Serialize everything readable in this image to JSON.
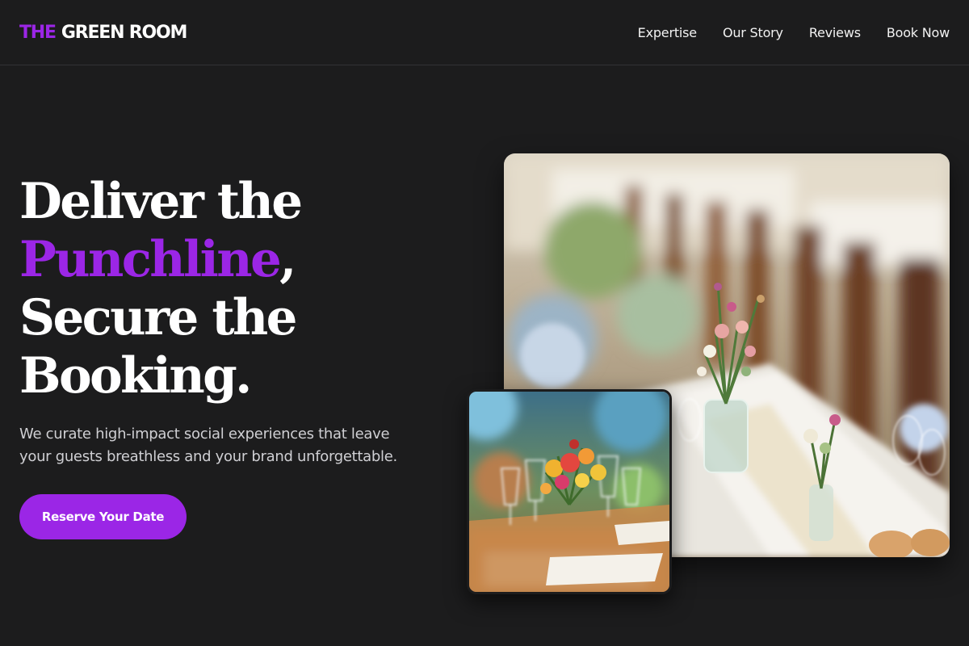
{
  "header": {
    "logo_accent": "THE",
    "logo_rest": "GREEN ROOM",
    "nav": [
      {
        "label": "Expertise"
      },
      {
        "label": "Our Story"
      },
      {
        "label": "Reviews"
      },
      {
        "label": "Book Now"
      }
    ]
  },
  "hero": {
    "title_line1": "Deliver the",
    "title_highlight": "Punchline",
    "title_comma": ",",
    "title_line3": "Secure the",
    "title_line4": "Booking.",
    "subtitle_line1": "We curate high-impact social experiences that leave",
    "subtitle_line2": "your guests breathless and your brand unforgettable.",
    "cta_label": "Reserve Your Date"
  },
  "images": {
    "main_alt": "Long banquet table with floral centerpieces",
    "inset_alt": "Table setting with colorful flower arrangement"
  },
  "colors": {
    "background": "#1c1c1d",
    "accent": "#9b26e6",
    "text": "#ffffff"
  }
}
